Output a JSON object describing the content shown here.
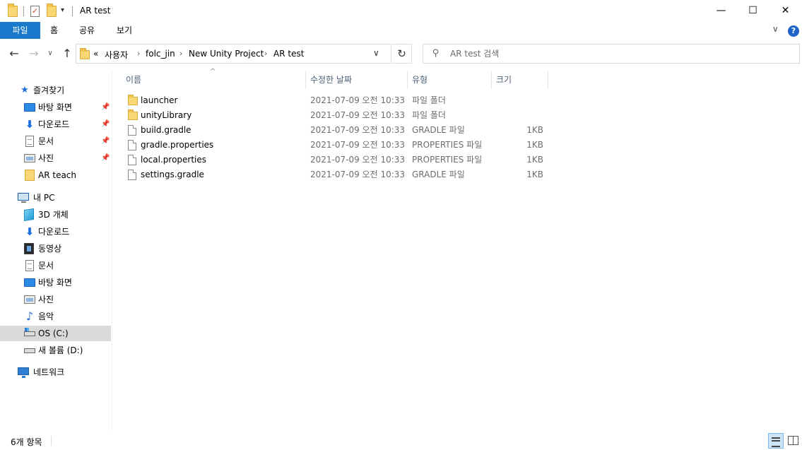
{
  "window": {
    "title": "AR test",
    "minimize_glyph": "—",
    "maximize_glyph": "☐",
    "close_glyph": "✕",
    "qa_dropdown_glyph": "▾",
    "props_glyph": "✓"
  },
  "ribbon": {
    "tabs": [
      {
        "label": "파일",
        "active": true
      },
      {
        "label": "홈"
      },
      {
        "label": "공유"
      },
      {
        "label": "보기"
      }
    ],
    "expand_glyph": "∨",
    "help_glyph": "?"
  },
  "navigation": {
    "back_glyph": "←",
    "forward_glyph": "→",
    "recent_glyph": "∨",
    "up_glyph": "↑",
    "refresh_glyph": "↻",
    "address_dropdown_glyph": "∨",
    "breadcrumb_overflow": "«",
    "breadcrumb_sep": "›",
    "breadcrumb": [
      "사용자",
      "folc_jin",
      "New Unity Project",
      "AR test"
    ]
  },
  "search": {
    "placeholder": "AR test 검색",
    "icon": "search-icon",
    "glyph": "⚲"
  },
  "sidebar": {
    "pin_glyph": "📌",
    "star_glyph": "★",
    "download_glyph": "⬇",
    "music_glyph": "♪",
    "items": [
      {
        "label": "즐겨찾기",
        "icon": "star-icon"
      },
      {
        "label": "바탕 화면",
        "icon": "desktop-icon",
        "pinned": true
      },
      {
        "label": "다운로드",
        "icon": "download-icon",
        "pinned": true
      },
      {
        "label": "문서",
        "icon": "document-icon",
        "pinned": true
      },
      {
        "label": "사진",
        "icon": "pictures-icon",
        "pinned": true
      },
      {
        "label": "AR teach",
        "icon": "folder-icon"
      },
      {
        "label": "내 PC",
        "icon": "pc-icon"
      },
      {
        "label": "3D 개체",
        "icon": "3d-objects-icon"
      },
      {
        "label": "다운로드",
        "icon": "download-icon"
      },
      {
        "label": "동영상",
        "icon": "video-icon"
      },
      {
        "label": "문서",
        "icon": "document-icon"
      },
      {
        "label": "바탕 화면",
        "icon": "desktop-icon"
      },
      {
        "label": "사진",
        "icon": "pictures-icon"
      },
      {
        "label": "음악",
        "icon": "music-icon"
      },
      {
        "label": "OS (C:)",
        "icon": "drive-c-icon",
        "selected": true
      },
      {
        "label": "새 볼륨 (D:)",
        "icon": "drive-icon"
      },
      {
        "label": "네트워크",
        "icon": "network-icon"
      }
    ]
  },
  "columns": {
    "sort_glyph": "^",
    "name": "이름",
    "date": "수정한 날짜",
    "type": "유형",
    "size": "크기"
  },
  "files": [
    {
      "name": "launcher",
      "date": "2021-07-09 오전 10:33",
      "type": "파일 폴더",
      "size": "",
      "icon": "folder-icon"
    },
    {
      "name": "unityLibrary",
      "date": "2021-07-09 오전 10:33",
      "type": "파일 폴더",
      "size": "",
      "icon": "folder-icon"
    },
    {
      "name": "build.gradle",
      "date": "2021-07-09 오전 10:33",
      "type": "GRADLE 파일",
      "size": "1KB",
      "icon": "file-icon"
    },
    {
      "name": "gradle.properties",
      "date": "2021-07-09 오전 10:33",
      "type": "PROPERTIES 파일",
      "size": "1KB",
      "icon": "file-icon"
    },
    {
      "name": "local.properties",
      "date": "2021-07-09 오전 10:33",
      "type": "PROPERTIES 파일",
      "size": "1KB",
      "icon": "file-icon"
    },
    {
      "name": "settings.gradle",
      "date": "2021-07-09 오전 10:33",
      "type": "GRADLE 파일",
      "size": "1KB",
      "icon": "file-icon"
    }
  ],
  "status": {
    "item_count": "6개 항목"
  },
  "colors": {
    "file_tab_bg": "#1979ca",
    "selected_bg": "#d9d9d9",
    "column_header_text": "#4c607a",
    "secondary_text": "#6d6d6d",
    "folder_yellow": "#f8d775",
    "accent_blue": "#1e6fd9"
  }
}
